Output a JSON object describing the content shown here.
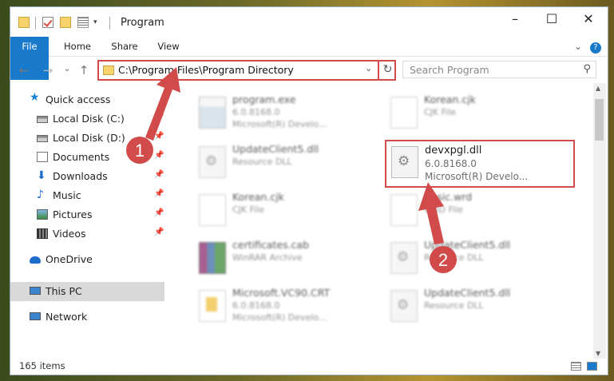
{
  "window": {
    "title": "Program",
    "minimize": "–",
    "maximize": "☐",
    "close": "✕"
  },
  "ribbon": {
    "tabs": [
      "File",
      "Home",
      "Share",
      "View"
    ],
    "expand": "⌄",
    "help": "?"
  },
  "nav": {
    "back": "←",
    "forward": "→",
    "recent": "⌄",
    "up": "↑"
  },
  "address": {
    "path": "C:\\Program Files\\Program Directory",
    "dropdown": "⌄",
    "refresh": "↻"
  },
  "search": {
    "placeholder": "Search Program",
    "icon": "⚲"
  },
  "sidebar": {
    "items": [
      {
        "label": "Quick access",
        "pinned": false
      },
      {
        "label": "Local Disk (C:)",
        "pinned": true
      },
      {
        "label": "Local Disk (D:)",
        "pinned": true
      },
      {
        "label": "Documents",
        "pinned": true
      },
      {
        "label": "Downloads",
        "pinned": true
      },
      {
        "label": "Music",
        "pinned": true
      },
      {
        "label": "Pictures",
        "pinned": true
      },
      {
        "label": "Videos",
        "pinned": true
      },
      {
        "label": "OneDrive",
        "pinned": false
      },
      {
        "label": "This PC",
        "pinned": false
      },
      {
        "label": "Network",
        "pinned": false
      }
    ]
  },
  "files": [
    {
      "name": "program.exe",
      "line2": "6.0.8168.0",
      "line3": "Microsoft(R) Develo...",
      "icon": "exe-icon"
    },
    {
      "name": "Korean.cjk",
      "line2": "CJK File",
      "line3": "",
      "icon": "document-icon"
    },
    {
      "name": "UpdateClient5.dll",
      "line2": "Resource DLL",
      "line3": "",
      "icon": "dll-icon"
    },
    {
      "name": "devxpgl.dll",
      "line2": "6.0.8168.0",
      "line3": "Microsoft(R) Develo...",
      "icon": "dll-icon"
    },
    {
      "name": "Korean.cjk",
      "line2": "CJK File",
      "line3": "",
      "icon": "document-icon"
    },
    {
      "name": "Basic.wrd",
      "line2": "WRD File",
      "line3": "",
      "icon": "document-icon"
    },
    {
      "name": "certificates.cab",
      "line2": "WinRAR Archive",
      "line3": "",
      "icon": "archive-icon"
    },
    {
      "name": "UpdateClient5.dll",
      "line2": "Resource DLL",
      "line3": "",
      "icon": "dll-icon"
    },
    {
      "name": "Microsoft.VC90.CRT",
      "line2": "6.0.8168.0",
      "line3": "Microsoft(R) Develo...",
      "icon": "crt-icon"
    },
    {
      "name": "UpdateClient5.dll",
      "line2": "Resource DLL",
      "line3": "",
      "icon": "dll-icon"
    }
  ],
  "status": {
    "count": "165 items"
  },
  "annotations": {
    "step1": "1",
    "step2": "2",
    "color": "#d24b4b"
  },
  "pin_glyph": "📌"
}
